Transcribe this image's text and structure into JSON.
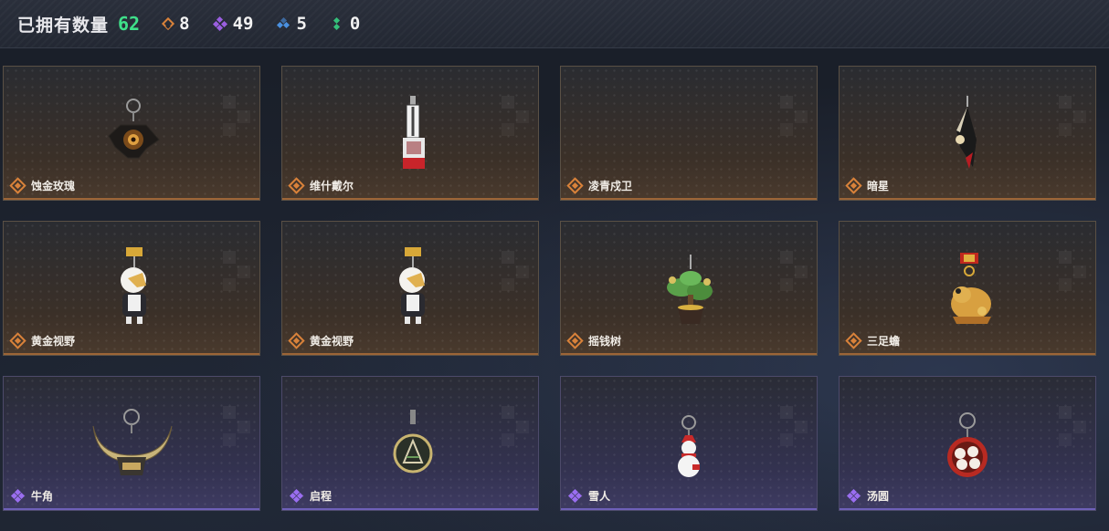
{
  "header": {
    "owned_label": "已拥有数量",
    "owned_total": "62",
    "stats": [
      {
        "icon": "orange-diamond-icon",
        "count": "8"
      },
      {
        "icon": "purple-quad-diamond-icon",
        "count": "49"
      },
      {
        "icon": "blue-diamond-icon",
        "count": "5"
      },
      {
        "icon": "green-diamond-icon",
        "count": "0"
      }
    ]
  },
  "colors": {
    "orange_rarity": "#d9823a",
    "purple_rarity": "#9a6ef0",
    "green_total": "#3fe08a",
    "blue_rarity": "#4a90e0"
  },
  "items": [
    {
      "name": "蚀金玫瑰",
      "rarity": "orange",
      "icon": "rose-charm-icon"
    },
    {
      "name": "维什戴尔",
      "rarity": "orange",
      "icon": "tag-charm-icon"
    },
    {
      "name": "凌青戍卫",
      "rarity": "orange",
      "icon": "empty-icon"
    },
    {
      "name": "暗星",
      "rarity": "orange",
      "icon": "blade-charm-icon"
    },
    {
      "name": "黄金视野",
      "rarity": "orange",
      "icon": "figure-charm-icon"
    },
    {
      "name": "黄金视野",
      "rarity": "orange",
      "icon": "figure-charm-icon"
    },
    {
      "name": "摇钱树",
      "rarity": "orange",
      "icon": "money-tree-charm-icon"
    },
    {
      "name": "三足蟾",
      "rarity": "orange",
      "icon": "toad-charm-icon"
    },
    {
      "name": "牛角",
      "rarity": "purple",
      "icon": "horns-charm-icon"
    },
    {
      "name": "启程",
      "rarity": "purple",
      "icon": "medal-charm-icon"
    },
    {
      "name": "雪人",
      "rarity": "purple",
      "icon": "snowman-charm-icon"
    },
    {
      "name": "汤圆",
      "rarity": "purple",
      "icon": "tangyuan-charm-icon"
    }
  ]
}
